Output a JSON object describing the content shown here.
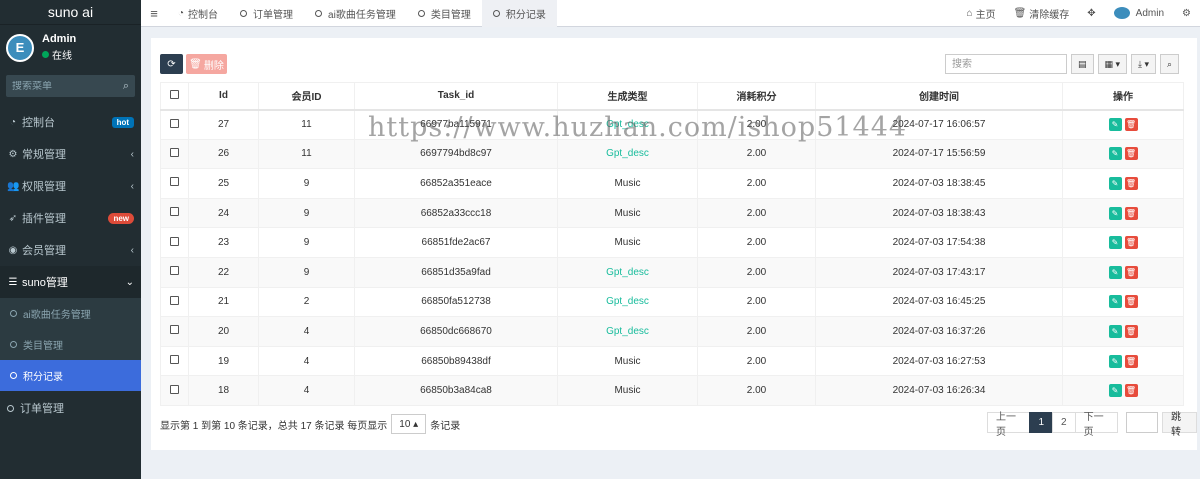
{
  "brand": "suno ai",
  "user": {
    "name": "Admin",
    "status": "在线",
    "avatar_letter": "E"
  },
  "sidebar_search": {
    "placeholder": "搜索菜单"
  },
  "menu": [
    {
      "label": "控制台",
      "icon": "dashboard-icon",
      "badge": "hot"
    },
    {
      "label": "常规管理",
      "icon": "cogs-icon",
      "chevron": "‹"
    },
    {
      "label": "权限管理",
      "icon": "users-icon",
      "chevron": "‹"
    },
    {
      "label": "插件管理",
      "icon": "rocket-icon",
      "badge": "new"
    },
    {
      "label": "会员管理",
      "icon": "user-circle-icon",
      "chevron": "‹"
    },
    {
      "label": "suno管理",
      "icon": "list-icon",
      "chevron": "⌄"
    }
  ],
  "submenu": [
    {
      "label": "ai歌曲任务管理"
    },
    {
      "label": "类目管理"
    },
    {
      "label": "积分记录"
    }
  ],
  "menu_bottom": {
    "label": "订单管理"
  },
  "tabs": [
    {
      "label": "控制台"
    },
    {
      "label": "订单管理"
    },
    {
      "label": "ai歌曲任务管理"
    },
    {
      "label": "类目管理"
    },
    {
      "label": "积分记录"
    }
  ],
  "topright": {
    "home": "主页",
    "clear_cache": "清除缓存",
    "admin": "Admin"
  },
  "toolbar": {
    "delete_label": "删除",
    "search_placeholder": "搜索"
  },
  "table": {
    "headers": [
      "Id",
      "会员ID",
      "Task_id",
      "生成类型",
      "消耗积分",
      "创建时间",
      "操作"
    ],
    "rows": [
      {
        "id": "27",
        "member": "11",
        "task": "66977ba115971",
        "type": "Gpt_desc",
        "points": "2.00",
        "created": "2024-07-17 16:06:57"
      },
      {
        "id": "26",
        "member": "11",
        "task": "6697794bd8c97",
        "type": "Gpt_desc",
        "points": "2.00",
        "created": "2024-07-17 15:56:59"
      },
      {
        "id": "25",
        "member": "9",
        "task": "66852a351eace",
        "type": "Music",
        "points": "2.00",
        "created": "2024-07-03 18:38:45"
      },
      {
        "id": "24",
        "member": "9",
        "task": "66852a33ccc18",
        "type": "Music",
        "points": "2.00",
        "created": "2024-07-03 18:38:43"
      },
      {
        "id": "23",
        "member": "9",
        "task": "66851fde2ac67",
        "type": "Music",
        "points": "2.00",
        "created": "2024-07-03 17:54:38"
      },
      {
        "id": "22",
        "member": "9",
        "task": "66851d35a9fad",
        "type": "Gpt_desc",
        "points": "2.00",
        "created": "2024-07-03 17:43:17"
      },
      {
        "id": "21",
        "member": "2",
        "task": "66850fa512738",
        "type": "Gpt_desc",
        "points": "2.00",
        "created": "2024-07-03 16:45:25"
      },
      {
        "id": "20",
        "member": "4",
        "task": "66850dc668670",
        "type": "Gpt_desc",
        "points": "2.00",
        "created": "2024-07-03 16:37:26"
      },
      {
        "id": "19",
        "member": "4",
        "task": "66850b89438df",
        "type": "Music",
        "points": "2.00",
        "created": "2024-07-03 16:27:53"
      },
      {
        "id": "18",
        "member": "4",
        "task": "66850b3a84ca8",
        "type": "Music",
        "points": "2.00",
        "created": "2024-07-03 16:26:34"
      }
    ]
  },
  "footer": {
    "info_prefix": "显示第 1 到第 10 条记录，总共 17 条记录 每页显示",
    "page_size": "10",
    "info_suffix": "条记录"
  },
  "pager": {
    "prev": "上一页",
    "pages": [
      "1",
      "2"
    ],
    "next": "下一页",
    "jump": "跳转"
  },
  "watermark": "https://www.huzhan.com/ishop51444",
  "colors": {
    "sidebar": "#222d32",
    "active": "#3c6cdc",
    "accent": "#18bc9c",
    "danger": "#e74c3c"
  }
}
